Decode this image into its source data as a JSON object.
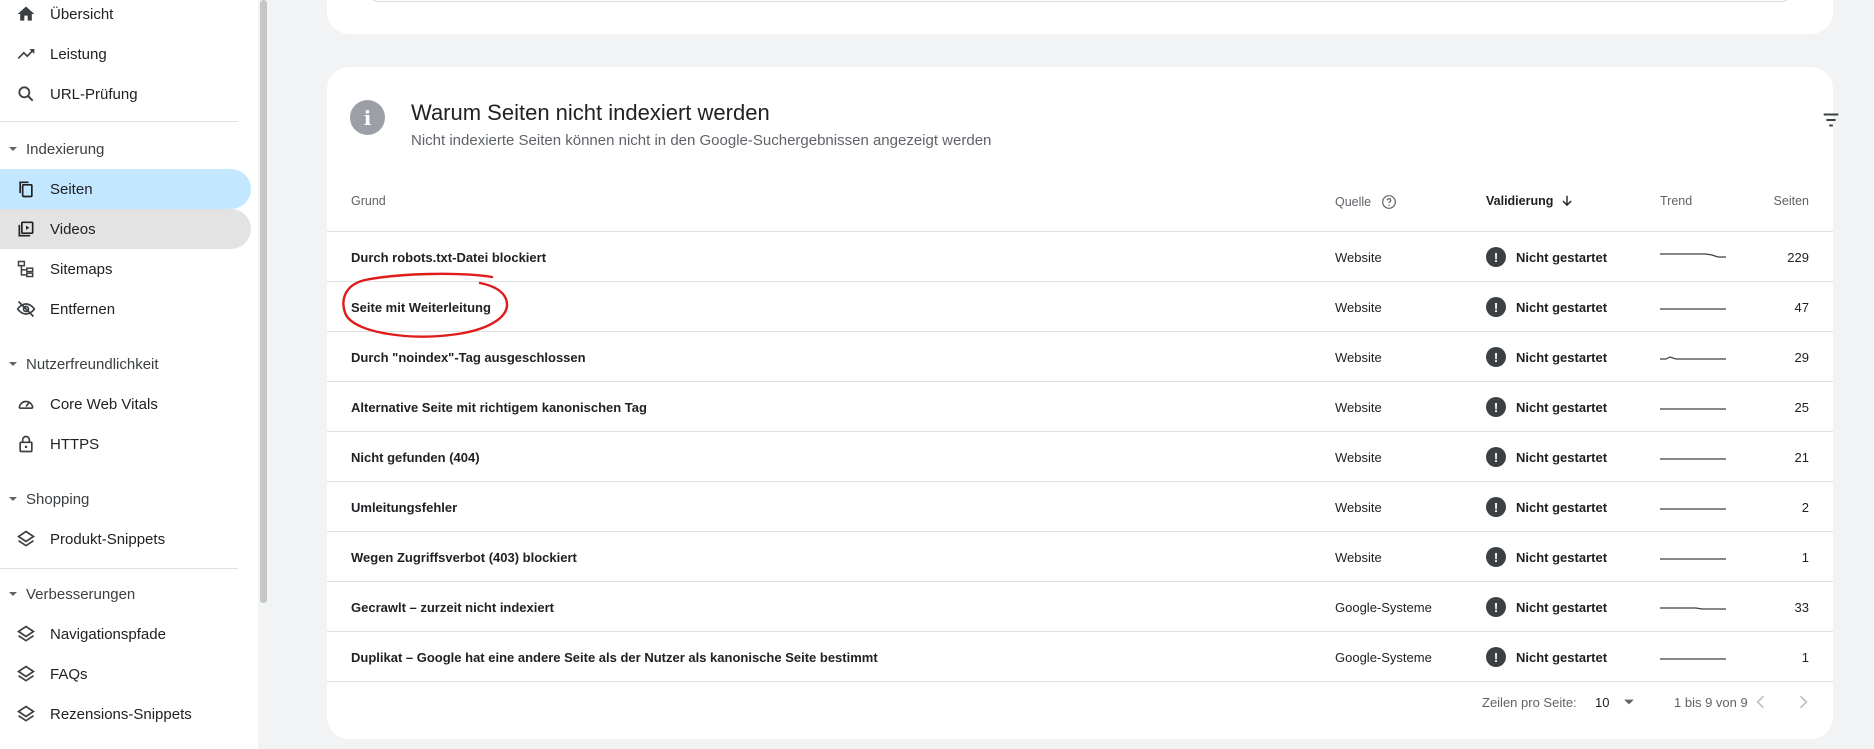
{
  "sidebar": {
    "items_top": [
      {
        "label": "Übersicht",
        "icon": "home-icon"
      },
      {
        "label": "Leistung",
        "icon": "trending-up-icon"
      },
      {
        "label": "URL-Prüfung",
        "icon": "search-icon"
      }
    ],
    "sections": [
      {
        "label": "Indexierung",
        "items": [
          {
            "label": "Seiten",
            "icon": "pages-icon",
            "state": "active"
          },
          {
            "label": "Videos",
            "icon": "video-library-icon",
            "state": "hover"
          },
          {
            "label": "Sitemaps",
            "icon": "sitemap-icon"
          },
          {
            "label": "Entfernen",
            "icon": "visibility-off-icon"
          }
        ]
      },
      {
        "label": "Nutzerfreundlichkeit",
        "items": [
          {
            "label": "Core Web Vitals",
            "icon": "speed-gauge-icon"
          },
          {
            "label": "HTTPS",
            "icon": "lock-icon"
          }
        ]
      },
      {
        "label": "Shopping",
        "items": [
          {
            "label": "Produkt-Snippets",
            "icon": "layers-icon"
          }
        ]
      },
      {
        "label": "Verbesserungen",
        "items": [
          {
            "label": "Navigationspfade",
            "icon": "layers-icon"
          },
          {
            "label": "FAQs",
            "icon": "layers-icon"
          },
          {
            "label": "Rezensions-Snippets",
            "icon": "layers-icon"
          }
        ]
      }
    ]
  },
  "panel": {
    "title": "Warum Seiten nicht indexiert werden",
    "subtitle": "Nicht indexierte Seiten können nicht in den Google-Suchergebnissen angezeigt werden",
    "columns": {
      "grund": "Grund",
      "quelle": "Quelle",
      "validierung": "Validierung",
      "trend": "Trend",
      "seiten": "Seiten"
    },
    "rows": [
      {
        "grund": "Durch robots.txt-Datei blockiert",
        "quelle": "Website",
        "validierung": "Nicht gestartet",
        "seiten": "229"
      },
      {
        "grund": "Seite mit Weiterleitung",
        "quelle": "Website",
        "validierung": "Nicht gestartet",
        "seiten": "47"
      },
      {
        "grund": "Durch \"noindex\"-Tag ausgeschlossen",
        "quelle": "Website",
        "validierung": "Nicht gestartet",
        "seiten": "29"
      },
      {
        "grund": "Alternative Seite mit richtigem kanonischen Tag",
        "quelle": "Website",
        "validierung": "Nicht gestartet",
        "seiten": "25"
      },
      {
        "grund": "Nicht gefunden (404)",
        "quelle": "Website",
        "validierung": "Nicht gestartet",
        "seiten": "21"
      },
      {
        "grund": "Umleitungsfehler",
        "quelle": "Website",
        "validierung": "Nicht gestartet",
        "seiten": "2"
      },
      {
        "grund": "Wegen Zugriffsverbot (403) blockiert",
        "quelle": "Website",
        "validierung": "Nicht gestartet",
        "seiten": "1"
      },
      {
        "grund": "Gecrawlt – zurzeit nicht indexiert",
        "quelle": "Google-Systeme",
        "validierung": "Nicht gestartet",
        "seiten": "33"
      },
      {
        "grund": "Duplikat – Google hat eine andere Seite als der Nutzer als kanonische Seite bestimmt",
        "quelle": "Google-Systeme",
        "validierung": "Nicht gestartet",
        "seiten": "1"
      }
    ],
    "footer": {
      "rows_label": "Zeilen pro Seite:",
      "rows_value": "10",
      "range": "1 bis 9 von 9"
    }
  },
  "colors": {
    "active_nav": "#c2e7ff",
    "annotation": "#e01b1b"
  }
}
